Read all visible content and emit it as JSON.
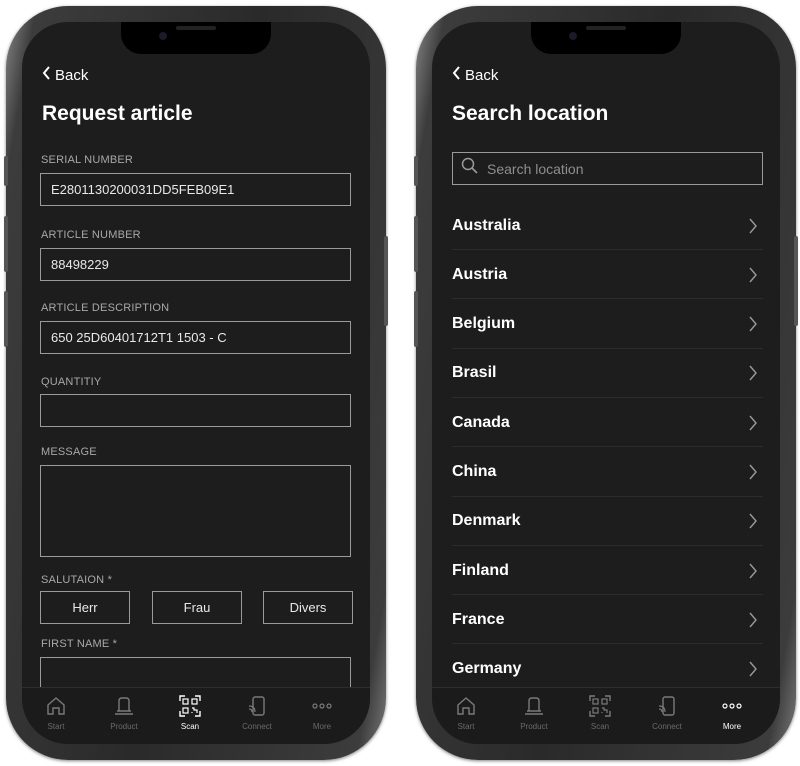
{
  "left_screen": {
    "back_label": "Back",
    "title": "Request article",
    "fields": [
      {
        "label": "SERIAL NUMBER",
        "value": "E2801130200031DD5FEB09E1"
      },
      {
        "label": "ARTICLE NUMBER",
        "value": "88498229"
      },
      {
        "label": "ARTICLE DESCRIPTION",
        "value": "650 25D60401712T1 1503 - C"
      },
      {
        "label": "QUANTITIY",
        "value": ""
      },
      {
        "label": "MESSAGE",
        "value": ""
      }
    ],
    "salutation": {
      "label": "SALUTAION *",
      "options": [
        "Herr",
        "Frau",
        "Divers"
      ]
    },
    "first_name": {
      "label": "FIRST NAME *",
      "value": ""
    }
  },
  "right_screen": {
    "back_label": "Back",
    "title": "Search location",
    "search_placeholder": "Search location",
    "countries": [
      "Australia",
      "Austria",
      "Belgium",
      "Brasil",
      "Canada",
      "China",
      "Denmark",
      "Finland",
      "France",
      "Germany"
    ]
  },
  "tabbar": {
    "tabs": [
      {
        "label": "Start",
        "icon": "home-icon"
      },
      {
        "label": "Product",
        "icon": "product-icon"
      },
      {
        "label": "Scan",
        "icon": "qr-scan-icon"
      },
      {
        "label": "Connect",
        "icon": "phone-connect-icon"
      },
      {
        "label": "More",
        "icon": "more-icon"
      }
    ],
    "left_active": "Scan",
    "right_active": "More"
  },
  "colors": {
    "screen_bg": "#1d1d1d",
    "text": "#ffffff",
    "muted_label": "#a8a8a8",
    "border": "#9a9a9a",
    "inactive_tab": "#6a6a6a"
  }
}
